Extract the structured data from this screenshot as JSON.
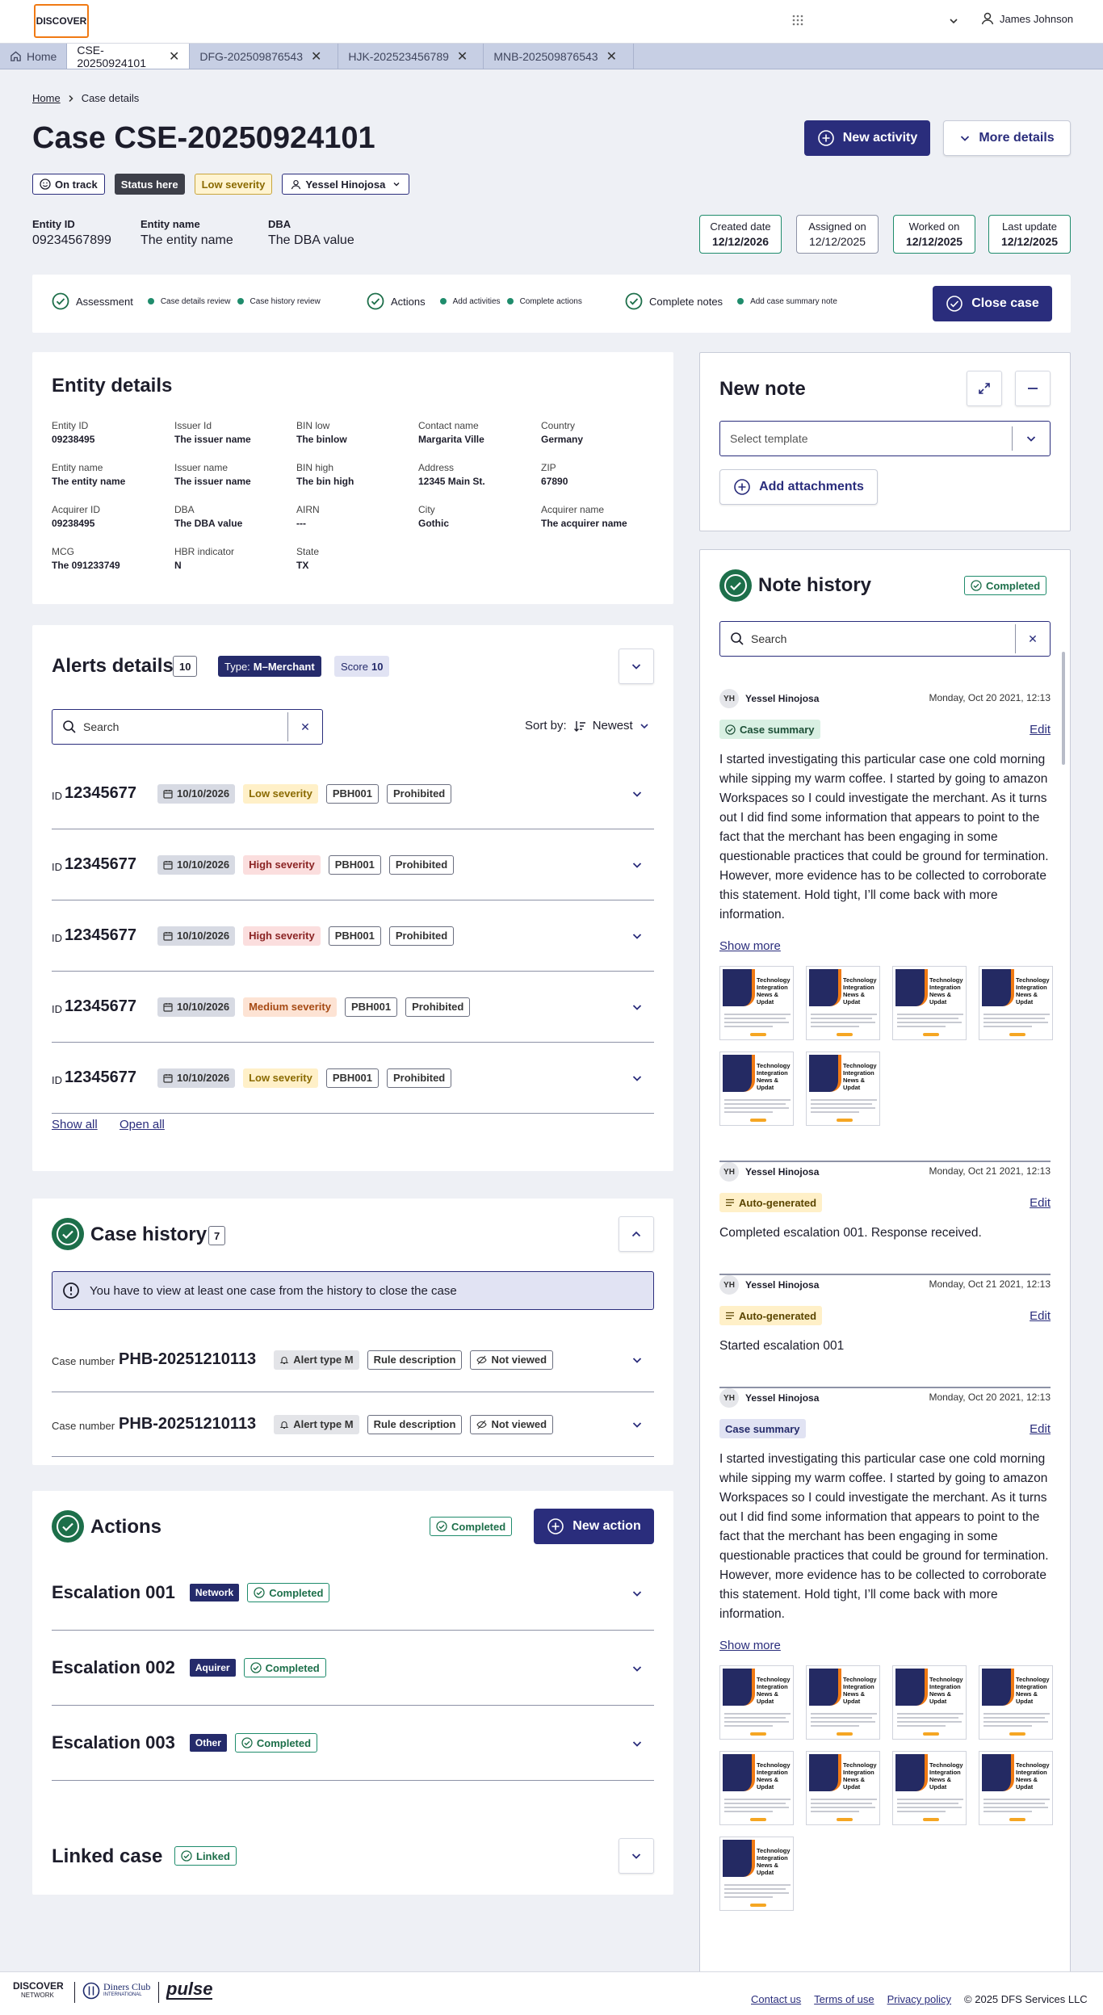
{
  "header": {
    "logo": "DISCOVER",
    "user_name": "James Johnson"
  },
  "tabs": [
    {
      "label": "Home"
    },
    {
      "label": "CSE-20250924101"
    },
    {
      "label": "DFG-202509876543"
    },
    {
      "label": "HJK-202523456789"
    },
    {
      "label": "MNB-202509876543"
    }
  ],
  "breadcrumb": {
    "home": "Home",
    "current": "Case details"
  },
  "case": {
    "title": "Case CSE-20250924101",
    "new_activity": "New activity",
    "more_details": "More details",
    "badges": {
      "on_track": "On track",
      "status": "Status here",
      "severity": "Low severity",
      "assignee": "Yessel Hinojosa"
    },
    "info": [
      {
        "label": "Entity ID",
        "value": "09234567899"
      },
      {
        "label": "Entity name",
        "value": "The entity name"
      },
      {
        "label": "DBA",
        "value": "The DBA value"
      }
    ],
    "dates": [
      {
        "label": "Created date",
        "value": "12/12/2026"
      },
      {
        "label": "Assigned on",
        "value": "12/12/2025"
      },
      {
        "label": "Worked on",
        "value": "12/12/2025"
      },
      {
        "label": "Last update",
        "value": "12/12/2025"
      }
    ]
  },
  "progress": {
    "assessment": "Assessment",
    "case_details_review": "Case details review",
    "case_history_review": "Case history review",
    "actions": "Actions",
    "add_activities": "Add activities",
    "complete_actions": "Complete actions",
    "complete_notes": "Complete notes",
    "add_summary_note": "Add case summary note",
    "close_case": "Close case"
  },
  "entity_details": {
    "title": "Entity details",
    "fields": [
      {
        "k": "Entity ID",
        "v": "09238495"
      },
      {
        "k": "Issuer Id",
        "v": "The issuer name"
      },
      {
        "k": "BIN low",
        "v": "The binlow"
      },
      {
        "k": "Contact name",
        "v": "Margarita Ville"
      },
      {
        "k": "Country",
        "v": "Germany"
      },
      {
        "k": "Entity name",
        "v": "The entity name"
      },
      {
        "k": "Issuer name",
        "v": "The issuer name"
      },
      {
        "k": "BIN high",
        "v": "The bin high"
      },
      {
        "k": "Address",
        "v": "12345 Main St."
      },
      {
        "k": "ZIP",
        "v": "67890"
      },
      {
        "k": "Acquirer ID",
        "v": "09238495"
      },
      {
        "k": "DBA",
        "v": "The DBA value"
      },
      {
        "k": "AIRN",
        "v": "---"
      },
      {
        "k": "City",
        "v": "Gothic"
      },
      {
        "k": "Acquirer name",
        "v": "The acquirer name"
      },
      {
        "k": "MCG",
        "v": "The 091233749"
      },
      {
        "k": "HBR indicator",
        "v": "N"
      },
      {
        "k": "State",
        "v": "TX"
      }
    ]
  },
  "alerts": {
    "title": "Alerts details",
    "count": "10",
    "type_label": "Type:",
    "type_value": "M–Merchant",
    "score_label": "Score",
    "score_value": "10",
    "search_placeholder": "Search",
    "sort_label": "Sort by:",
    "sort_value": "Newest",
    "id_prefix": "ID",
    "rows": [
      {
        "id": "12345677",
        "date": "10/10/2026",
        "severity": "Low severity",
        "sev": "low",
        "code": "PBH001",
        "status": "Prohibited"
      },
      {
        "id": "12345677",
        "date": "10/10/2026",
        "severity": "High severity",
        "sev": "high",
        "code": "PBH001",
        "status": "Prohibited"
      },
      {
        "id": "12345677",
        "date": "10/10/2026",
        "severity": "High severity",
        "sev": "high",
        "code": "PBH001",
        "status": "Prohibited"
      },
      {
        "id": "12345677",
        "date": "10/10/2026",
        "severity": "Medium severity",
        "sev": "med",
        "code": "PBH001",
        "status": "Prohibited"
      },
      {
        "id": "12345677",
        "date": "10/10/2026",
        "severity": "Low severity",
        "sev": "low",
        "code": "PBH001",
        "status": "Prohibited"
      }
    ],
    "show_all": "Show all",
    "open_all": "Open all"
  },
  "case_history": {
    "title": "Case history",
    "count": "7",
    "info": "You have to view at least one case from the history to close the case",
    "case_number_label": "Case number",
    "rows": [
      {
        "number": "PHB-20251210113",
        "alert": "Alert type M",
        "rule": "Rule description",
        "viewed": "Not viewed"
      },
      {
        "number": "PHB-20251210113",
        "alert": "Alert type M",
        "rule": "Rule description",
        "viewed": "Not viewed"
      }
    ]
  },
  "actions": {
    "title": "Actions",
    "status": "Completed",
    "new_action": "New action",
    "rows": [
      {
        "name": "Escalation 001",
        "tag": "Network",
        "status": "Completed"
      },
      {
        "name": "Escalation 002",
        "tag": "Aquirer",
        "status": "Completed"
      },
      {
        "name": "Escalation 003",
        "tag": "Other",
        "status": "Completed"
      }
    ]
  },
  "linked_case": {
    "title": "Linked case",
    "status": "Linked"
  },
  "new_note": {
    "title": "New note",
    "template_placeholder": "Select template",
    "add_attachments": "Add attachments"
  },
  "note_history": {
    "title": "Note history",
    "status": "Completed",
    "search_placeholder": "Search",
    "edit": "Edit",
    "show_more": "Show more",
    "thumb_title": "Technology Integration News & Updat",
    "notes": [
      {
        "initials": "YH",
        "author": "Yessel Hinojosa",
        "time": "Monday, Oct 20 2021, 12:13",
        "tag": "Case summary",
        "text": "I started investigating this particular case one cold morning while sipping my warm coffee. I started by going to amazon Workspaces so I could investigate the merchant. As it turns out I did find some information that appears to point to the fact that the merchant has been engaging in some questionable practices that could be ground for termination. However, more evidence has to be collected to corroborate this statement.  Hold tight, I’ll come back with more information."
      },
      {
        "initials": "YH",
        "author": "Yessel Hinojosa",
        "time": "Monday, Oct 21 2021, 12:13",
        "tag": "Auto-generated",
        "text": "Completed escalation 001. Response received."
      },
      {
        "initials": "YH",
        "author": "Yessel Hinojosa",
        "time": "Monday, Oct 21 2021, 12:13",
        "tag": "Auto-generated",
        "text": "Started escalation 001"
      },
      {
        "initials": "YH",
        "author": "Yessel Hinojosa",
        "time": "Monday, Oct 20 2021, 12:13",
        "tag": "Case summary",
        "text": "I started investigating this particular case one cold morning while sipping my warm coffee. I started by going to amazon Workspaces so I could investigate the merchant. As it turns out I did find some information that appears to point to the fact that the merchant has been engaging in some questionable practices that could be ground for termination. However, more evidence has to be collected to corroborate this statement.  Hold tight, I’ll come back with more information."
      }
    ]
  },
  "footer": {
    "brand1_line1": "DISCOVER",
    "brand1_line2": "NETWORK",
    "brand2_line1": "Diners Club",
    "brand2_line2": "INTERNATIONAL",
    "brand3": "pulse",
    "contact": "Contact us",
    "terms": "Terms of use",
    "privacy": "Privacy policy",
    "copyright": "© 2025 DFS Services LLC"
  },
  "colors": {
    "navy": "#2a2d7c",
    "green": "#1d6f4a",
    "orange": "#f07a14"
  }
}
